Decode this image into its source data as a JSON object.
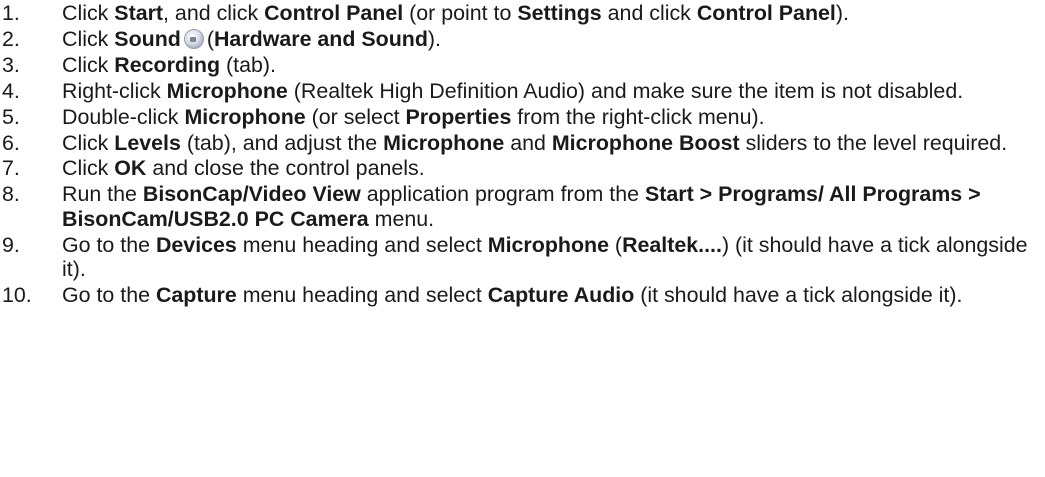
{
  "steps": [
    {
      "number": "1.",
      "segments": [
        {
          "t": "Click ",
          "b": false
        },
        {
          "t": "Start",
          "b": true
        },
        {
          "t": ", and click ",
          "b": false
        },
        {
          "t": "Control Panel",
          "b": true
        },
        {
          "t": " (or point to ",
          "b": false
        },
        {
          "t": "Settings",
          "b": true
        },
        {
          "t": " and click ",
          "b": false
        },
        {
          "t": "Control Panel",
          "b": true
        },
        {
          "t": ").",
          "b": false
        }
      ]
    },
    {
      "number": "2.",
      "segments": [
        {
          "t": "Click ",
          "b": false
        },
        {
          "t": "Sound",
          "b": true
        },
        {
          "icon": "sound-icon"
        },
        {
          "t": "(",
          "b": false
        },
        {
          "t": "Hardware and Sound",
          "b": true
        },
        {
          "t": ").",
          "b": false
        }
      ]
    },
    {
      "number": "3.",
      "segments": [
        {
          "t": "Click ",
          "b": false
        },
        {
          "t": "Recording",
          "b": true
        },
        {
          "t": " (tab).",
          "b": false
        }
      ]
    },
    {
      "number": "4.",
      "segments": [
        {
          "t": "Right-click ",
          "b": false
        },
        {
          "t": "Microphone",
          "b": true
        },
        {
          "t": " (Realtek High Definition Audio) and make sure the item is not disabled.",
          "b": false
        }
      ]
    },
    {
      "number": "5.",
      "segments": [
        {
          "t": "Double-click ",
          "b": false
        },
        {
          "t": "Microphone",
          "b": true
        },
        {
          "t": " (or select ",
          "b": false
        },
        {
          "t": "Properties",
          "b": true
        },
        {
          "t": " from the right-click menu).",
          "b": false
        }
      ]
    },
    {
      "number": "6.",
      "segments": [
        {
          "t": "Click ",
          "b": false
        },
        {
          "t": "Levels",
          "b": true
        },
        {
          "t": " (tab), and adjust the ",
          "b": false
        },
        {
          "t": "Microphone",
          "b": true
        },
        {
          "t": " and ",
          "b": false
        },
        {
          "t": "Microphone Boost",
          "b": true
        },
        {
          "t": " sliders to the level required.",
          "b": false
        }
      ]
    },
    {
      "number": "7.",
      "segments": [
        {
          "t": "Click ",
          "b": false
        },
        {
          "t": "OK",
          "b": true
        },
        {
          "t": " and close the control panels.",
          "b": false
        }
      ]
    },
    {
      "number": "8.",
      "segments": [
        {
          "t": "Run the ",
          "b": false
        },
        {
          "t": "BisonCap/Video View",
          "b": true
        },
        {
          "t": " application program from the ",
          "b": false
        },
        {
          "t": "Start > Programs/ All Programs > BisonCam/USB2.0 PC Camera",
          "b": true
        },
        {
          "t": " menu.",
          "b": false
        }
      ]
    },
    {
      "number": "9.",
      "segments": [
        {
          "t": "Go to the ",
          "b": false
        },
        {
          "t": "Devices",
          "b": true
        },
        {
          "t": " menu heading and select ",
          "b": false
        },
        {
          "t": "Microphone",
          "b": true
        },
        {
          "t": " (",
          "b": false
        },
        {
          "t": "Realtek....",
          "b": true
        },
        {
          "t": ") (it should have a tick alongside it).",
          "b": false
        }
      ]
    },
    {
      "number": "10.",
      "segments": [
        {
          "t": "Go to the ",
          "b": false
        },
        {
          "t": "Capture",
          "b": true
        },
        {
          "t": " menu heading and select ",
          "b": false
        },
        {
          "t": "Capture Audio",
          "b": true
        },
        {
          "t": " (it should have a tick alongside it).",
          "b": false
        }
      ]
    }
  ]
}
